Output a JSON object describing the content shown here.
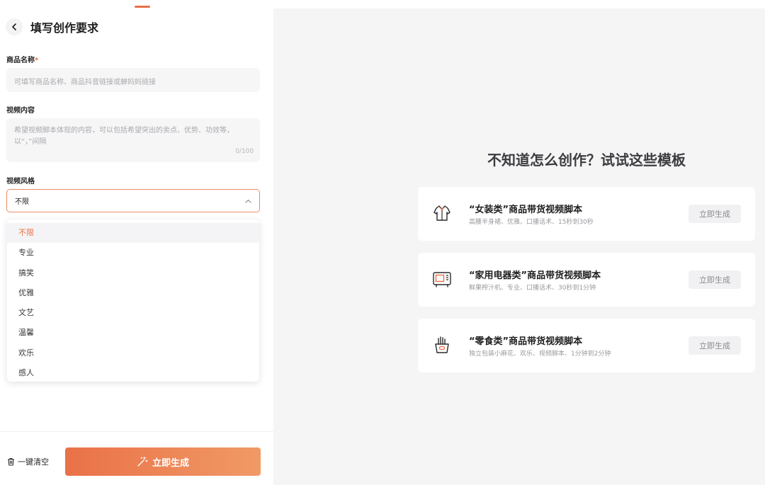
{
  "header": {
    "title": "填写创作要求"
  },
  "form": {
    "product_name": {
      "label": "商品名称",
      "required_mark": "*",
      "placeholder": "可填写商品名称、商品抖音链接或蝉妈妈链接"
    },
    "video_content": {
      "label": "视频内容",
      "placeholder": "希望视频脚本体现的内容，可以包括希望突出的卖点、优势、功效等，以“，”间隔",
      "counter": "0/100"
    },
    "video_style": {
      "label": "视频风格",
      "selected": "不限",
      "options": [
        "不限",
        "专业",
        "搞笑",
        "优雅",
        "文艺",
        "温馨",
        "欢乐",
        "感人"
      ]
    }
  },
  "footer": {
    "clear_label": "一键清空",
    "generate_label": "立即生成"
  },
  "templates": {
    "title": "不知道怎么创作？试试这些模板",
    "cards": [
      {
        "icon": "clothing-icon",
        "title": "“女装类”商品带货视频脚本",
        "subtitle": "高腰半身裙、优雅、口播话术、15秒到30秒",
        "button": "立即生成"
      },
      {
        "icon": "appliance-icon",
        "title": "“家用电器类”商品带货视频脚本",
        "subtitle": "鲜果榨汁机、专业、口播话术、30秒到1分钟",
        "button": "立即生成"
      },
      {
        "icon": "snack-icon",
        "title": "“零食类”商品带货视频脚本",
        "subtitle": "独立包装小麻花、欢乐、视频脚本、1分钟到2分钟",
        "button": "立即生成"
      }
    ]
  },
  "colors": {
    "accent": "#e9714a",
    "accent_gradient_end": "#f09a66",
    "panel_bg": "#f5f5f6"
  }
}
